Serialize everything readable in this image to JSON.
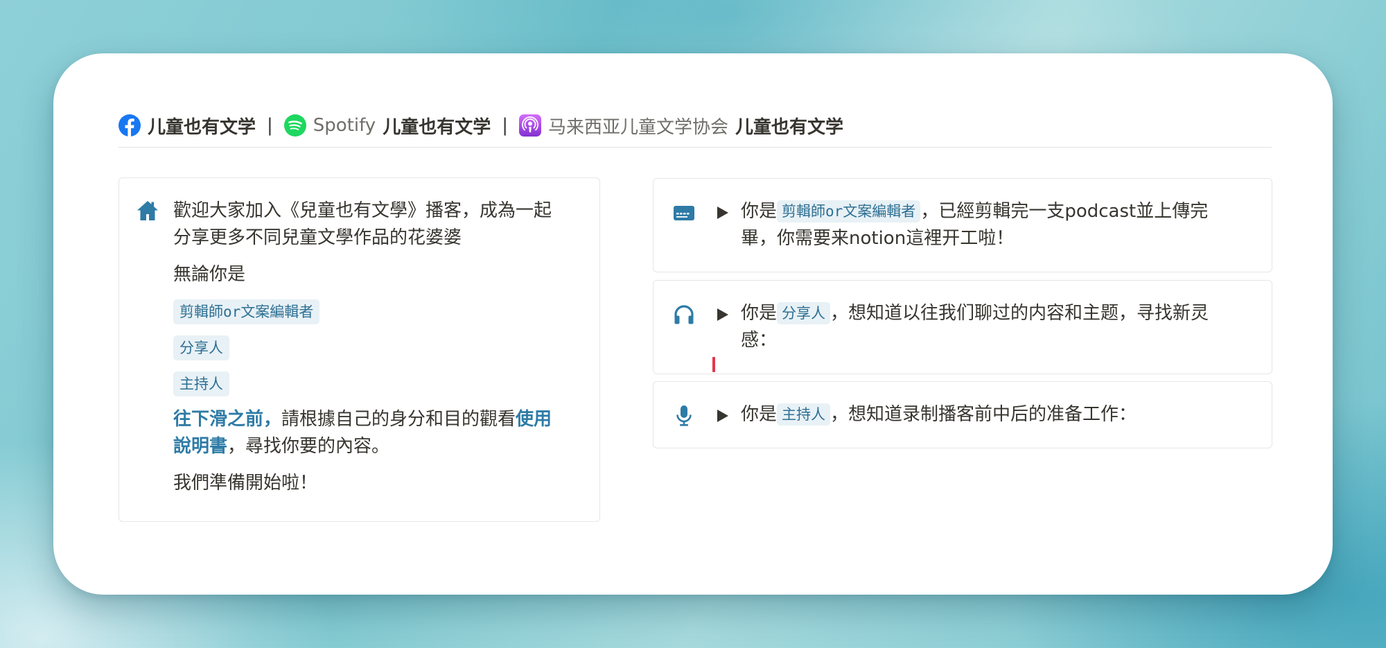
{
  "header": {
    "facebook_name": "儿童也有文学",
    "separator": "|",
    "spotify_label": "Spotify",
    "spotify_name": "儿童也有文学",
    "podcast_org": "马来西亚儿童文学协会",
    "podcast_name": "儿童也有文学",
    "icons": [
      "facebook-icon",
      "spotify-icon",
      "apple-podcasts-icon"
    ],
    "colors": {
      "facebook": "#1877f2",
      "spotify": "#1ed760",
      "podcasts": "#9b3fd8"
    }
  },
  "intro": {
    "icon": "home-icon",
    "welcome": "歡迎大家加入《兒童也有文學》播客，成為一起分享更多不同兒童文學作品的花婆婆",
    "whoever": "無論你是",
    "roles": [
      "剪輯師or文案編輯者",
      "分享人",
      "主持人"
    ],
    "instruction_bold": "往下滑之前，",
    "instruction_mid": "請根據自己的身分和目的觀看",
    "instruction_link": "使用說明書",
    "instruction_end": "，尋找你要的內容。",
    "ready": "我們準備開始啦！"
  },
  "toggles": [
    {
      "icon": "id-card-icon",
      "prefix": "你是",
      "role": "剪輯師or文案編輯者",
      "text": "，已經剪輯完一支podcast並上傳完畢，你需要来notion這裡开工啦！"
    },
    {
      "icon": "headphones-icon",
      "prefix": "你是",
      "role": "分享人",
      "text": "，想知道以往我们聊过的内容和主题，寻找新灵感："
    },
    {
      "icon": "microphone-icon",
      "prefix": "你是",
      "role": "主持人",
      "text": "，想知道录制播客前中后的准备工作："
    }
  ],
  "theme": {
    "accent": "#2e7ba6",
    "tag_bg": "#e8f1f6",
    "text": "#37352f",
    "caret": "#e5364d"
  }
}
